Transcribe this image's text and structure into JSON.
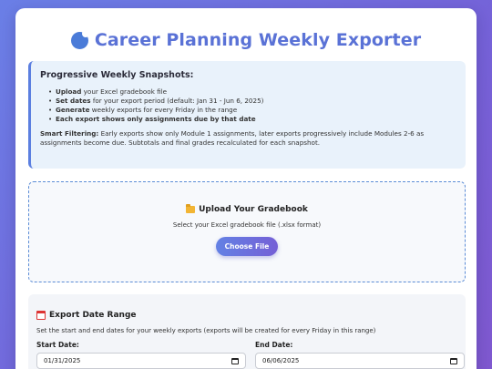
{
  "header": {
    "title": "Career Planning Weekly Exporter",
    "icon": "blue-circle-icon"
  },
  "info": {
    "heading": "Progressive Weekly Snapshots:",
    "items": [
      {
        "bold": "Upload",
        "text": " your Excel gradebook file"
      },
      {
        "bold": "Set dates",
        "text": " for your export period (default: Jan 31 - Jun 6, 2025)"
      },
      {
        "bold": "Generate",
        "text": " weekly exports for every Friday in the range"
      },
      {
        "bold": "Each export shows only assignments due by that date",
        "text": ""
      }
    ],
    "smart_label": "Smart Filtering:",
    "smart_text": " Early exports show only Module 1 assignments, later exports progressively include Modules 2-6 as assignments become due. Subtotals and final grades recalculated for each snapshot."
  },
  "upload": {
    "icon": "folder-icon",
    "title": "Upload Your Gradebook",
    "description": "Select your Excel gradebook file (.xlsx format)",
    "button_label": "Choose File"
  },
  "date_range": {
    "icon": "calendar-icon",
    "title": "Export Date Range",
    "description": "Set the start and end dates for your weekly exports (exports will be created for every Friday in this range)",
    "start_label": "Start Date:",
    "start_value": "01/31/2025",
    "end_label": "End Date:",
    "end_value": "06/06/2025"
  }
}
